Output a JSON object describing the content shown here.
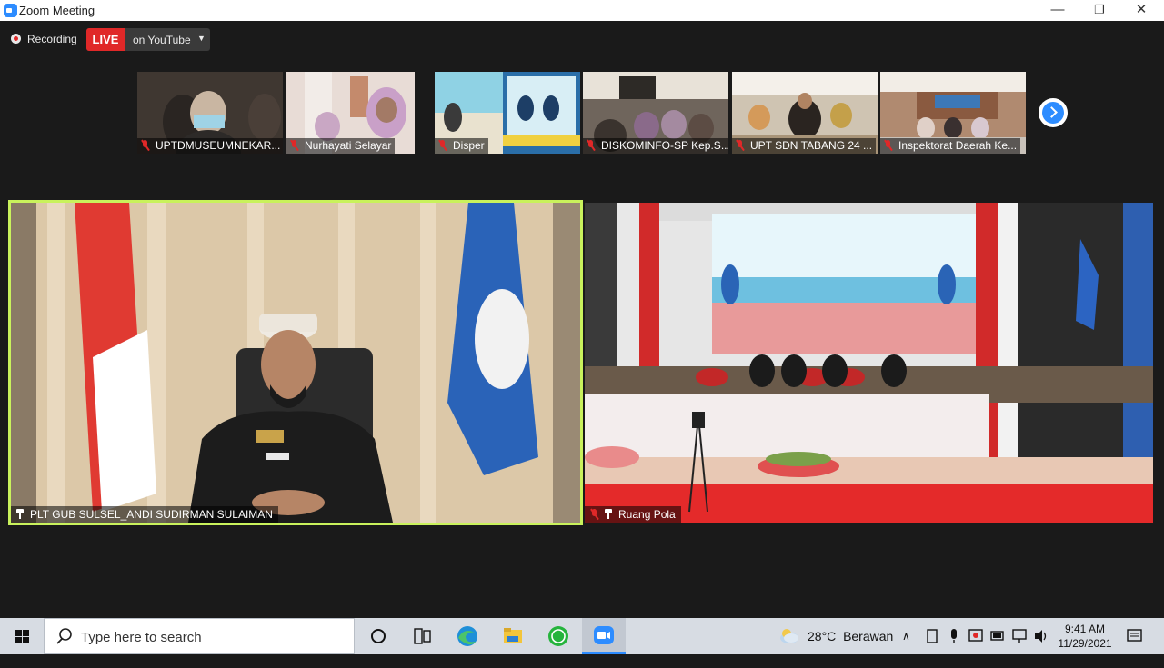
{
  "window": {
    "title": "Zoom Meeting",
    "controls": [
      "—",
      "❐",
      "✕"
    ]
  },
  "toolbar": {
    "recording_label": "Recording",
    "live_badge": "LIVE",
    "live_destination": "on YouTube",
    "dropdown_caret": "▼"
  },
  "thumbnails": [
    {
      "name": "UPTDMUSEUMNEKAR...",
      "muted": true,
      "bg": "#5a4e44"
    },
    {
      "name": "Nurhayati Selayar",
      "muted": true,
      "bg": "#d8c8c4"
    },
    {
      "name": "Disper",
      "muted": true,
      "bg": "#79c6d8"
    },
    {
      "name": "DISKOMINFO-SP Kep.S...",
      "muted": true,
      "bg": "#7c6a5c"
    },
    {
      "name": "UPT SDN TABANG 24 ...",
      "muted": true,
      "bg": "#b9a890"
    },
    {
      "name": "Inspektorat Daerah Ke...",
      "muted": true,
      "bg": "#a58670"
    }
  ],
  "tiles": [
    {
      "name": "PLT GUB SULSEL_ANDI SUDIRMAN SULAIMAN",
      "pinned": true,
      "muted": false,
      "active_speaker": true
    },
    {
      "name": "Ruang Pola",
      "pinned": true,
      "muted": true,
      "active_speaker": false
    }
  ],
  "taskbar": {
    "search_placeholder": "Type here to search",
    "weather_temp": "28°C",
    "weather_desc": "Berawan",
    "time": "9:41 AM",
    "date": "11/29/2021"
  },
  "colors": {
    "accent_blue": "#2d8cff",
    "live_red": "#e02828",
    "active_speaker_border": "#c9f25c"
  }
}
